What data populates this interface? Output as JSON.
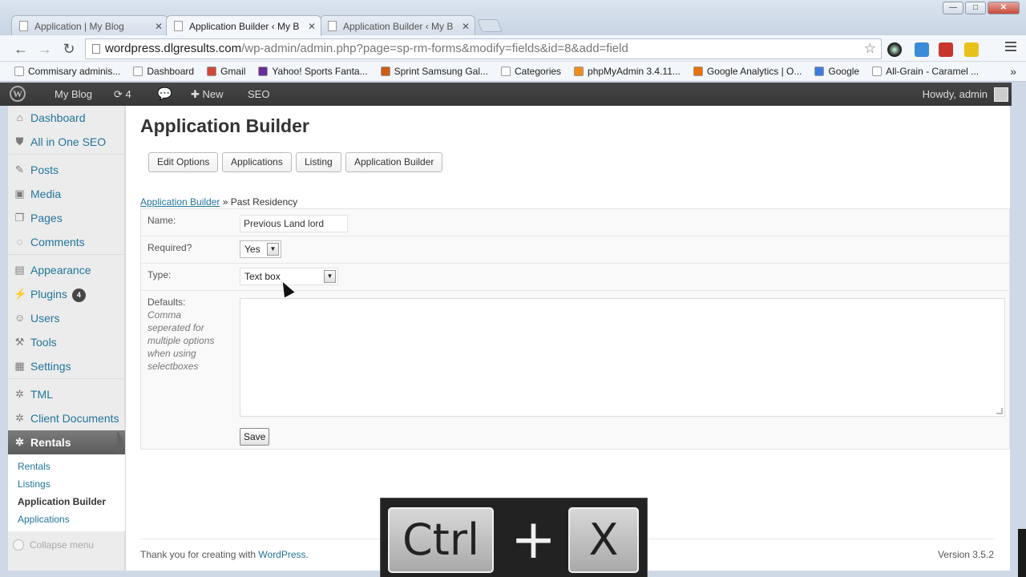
{
  "browser": {
    "tabs": [
      {
        "title": "Application | My Blog"
      },
      {
        "title": "Application Builder ‹ My B"
      },
      {
        "title": "Application Builder ‹ My B"
      }
    ],
    "url_host": "wordpress.dlgresults.com",
    "url_rest": "/wp-admin/admin.php?page=sp-rm-forms&modify=fields&id=8&add=field",
    "bookmarks": [
      {
        "label": "Commisary adminis...",
        "icon": "page-icon",
        "color": "#ffffff"
      },
      {
        "label": "Dashboard",
        "icon": "page-icon",
        "color": "#ffffff"
      },
      {
        "label": "Gmail",
        "icon": "gmail-icon",
        "color": "#d14836"
      },
      {
        "label": "Yahoo! Sports Fanta...",
        "icon": "yahoo-icon",
        "color": "#6b2d9c"
      },
      {
        "label": "Sprint Samsung Gal...",
        "icon": "xda-icon",
        "color": "#d25b12"
      },
      {
        "label": "Categories",
        "icon": "page-icon",
        "color": "#ffffff"
      },
      {
        "label": "phpMyAdmin 3.4.11...",
        "icon": "phpmyadmin-icon",
        "color": "#f28c1b"
      },
      {
        "label": "Google Analytics | O...",
        "icon": "analytics-icon",
        "color": "#e8710a"
      },
      {
        "label": "Google",
        "icon": "google-icon",
        "color": "#3d7be0"
      },
      {
        "label": "All-Grain - Caramel ...",
        "icon": "page-icon",
        "color": "#ffffff"
      }
    ],
    "more": "»"
  },
  "adminbar": {
    "site": "My Blog",
    "updates_count": "4",
    "new_label": "New",
    "seo_label": "SEO",
    "howdy": "Howdy, admin"
  },
  "sidebar": {
    "items": [
      {
        "label": "Dashboard",
        "icon": "dashboard-icon"
      },
      {
        "label": "All in One SEO",
        "icon": "shield-icon"
      },
      {
        "label": "Posts",
        "icon": "pin-icon"
      },
      {
        "label": "Media",
        "icon": "media-icon"
      },
      {
        "label": "Pages",
        "icon": "pages-icon"
      },
      {
        "label": "Comments",
        "icon": "comment-icon"
      },
      {
        "label": "Appearance",
        "icon": "appearance-icon"
      },
      {
        "label": "Plugins",
        "icon": "plug-icon",
        "badge": "4"
      },
      {
        "label": "Users",
        "icon": "users-icon"
      },
      {
        "label": "Tools",
        "icon": "tools-icon"
      },
      {
        "label": "Settings",
        "icon": "settings-icon"
      },
      {
        "label": "TML",
        "icon": "gear-icon"
      },
      {
        "label": "Client Documents",
        "icon": "gear-icon"
      },
      {
        "label": "Rentals",
        "icon": "gear-icon"
      }
    ],
    "submenu": [
      "Rentals",
      "Listings",
      "Application Builder",
      "Applications"
    ],
    "collapse": "Collapse menu"
  },
  "main": {
    "title": "Application Builder",
    "buttons": [
      "Edit Options",
      "Applications",
      "Listing",
      "Application Builder"
    ],
    "breadcrumb_link": "Application Builder",
    "breadcrumb_sep": " » ",
    "breadcrumb_current": "Past Residency",
    "form": {
      "name_label": "Name:",
      "name_value": "Previous Land lord",
      "required_label": "Required?",
      "required_value": "Yes",
      "type_label": "Type:",
      "type_value": "Text box",
      "defaults_label": "Defaults:",
      "defaults_hint": "Comma seperated for multiple options when using selectboxes",
      "defaults_value": "",
      "save_label": "Save"
    },
    "footer_text": "Thank you for creating with ",
    "footer_link": "WordPress",
    "footer_period": ".",
    "version": "Version 3.5.2"
  },
  "overlay": {
    "key1": "Ctrl",
    "plus": "+",
    "key2": "X"
  }
}
